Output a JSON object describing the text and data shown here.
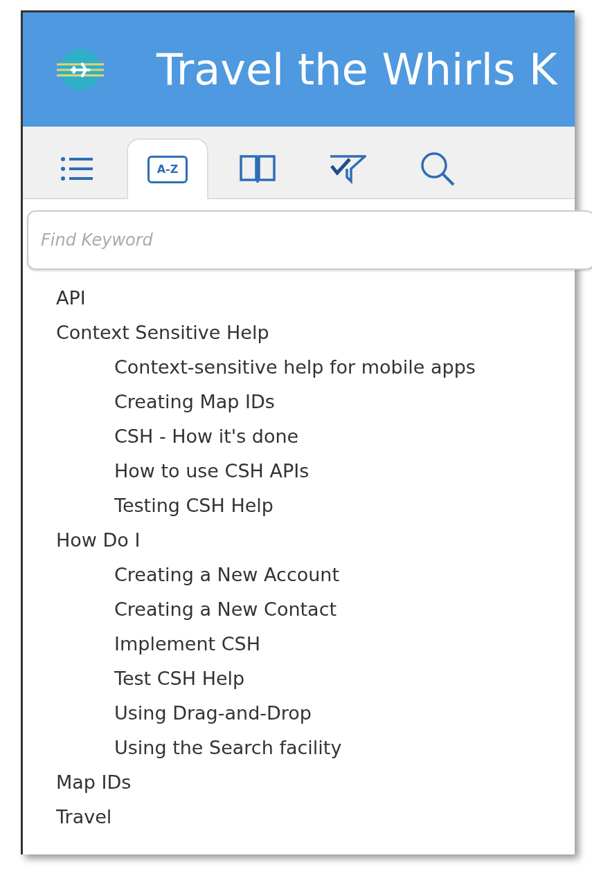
{
  "header": {
    "title": "Travel the Whirls K"
  },
  "tabs": [
    {
      "kind": "list",
      "selected": false
    },
    {
      "kind": "index",
      "label": "A-Z",
      "selected": true
    },
    {
      "kind": "book",
      "selected": false
    },
    {
      "kind": "filter",
      "selected": false
    },
    {
      "kind": "search",
      "selected": false
    }
  ],
  "search": {
    "placeholder": "Find Keyword"
  },
  "keywords": [
    {
      "label": "API"
    },
    {
      "label": "Context Sensitive Help",
      "children": [
        {
          "label": "Context-sensitive help for mobile apps"
        },
        {
          "label": "Creating Map IDs"
        },
        {
          "label": "CSH - How it's done"
        },
        {
          "label": "How to use CSH APIs"
        },
        {
          "label": "Testing CSH Help"
        }
      ]
    },
    {
      "label": "How Do I",
      "children": [
        {
          "label": "Creating a New Account"
        },
        {
          "label": "Creating a New Contact"
        },
        {
          "label": "Implement CSH"
        },
        {
          "label": "Test CSH Help"
        },
        {
          "label": "Using Drag-and-Drop"
        },
        {
          "label": "Using the Search facility"
        }
      ]
    },
    {
      "label": "Map IDs"
    },
    {
      "label": "Travel"
    }
  ]
}
